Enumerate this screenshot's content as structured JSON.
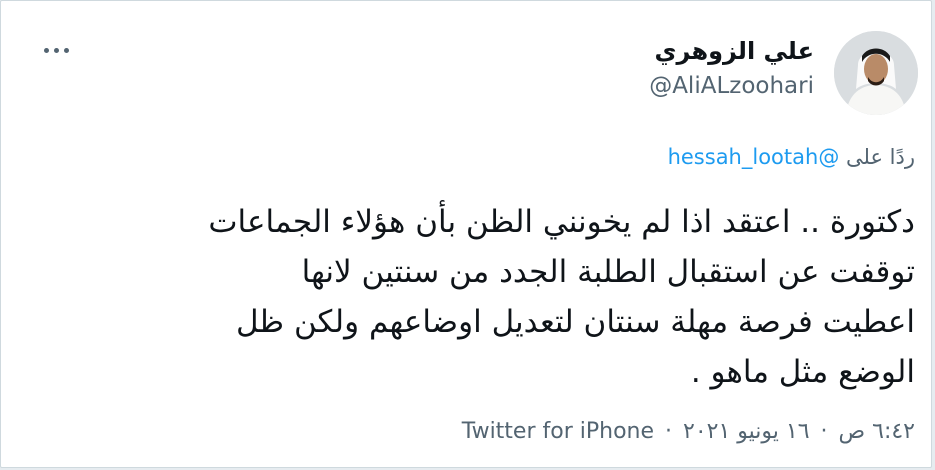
{
  "tweet": {
    "author": {
      "name": "علي الزوهري",
      "handle": "@AliALzoohari"
    },
    "reply": {
      "prefix": "ردًا على",
      "mention": "@hessah_lootah"
    },
    "text_lines": [
      "دكتورة .. اعتقد اذا لم يخونني الظن بأن هؤلاء الجماعات",
      "توقفت عن استقبال الطلبة الجدد من سنتين لانها",
      "اعطيت فرصة مهلة سنتان لتعديل اوضاعهم ولكن ظل",
      "الوضع مثل ماهو ."
    ],
    "meta": {
      "time": "٦:٤٢ ص",
      "separator": "·",
      "date": "١٦ يونيو ٢٠٢١",
      "source": "Twitter for iPhone"
    }
  },
  "icons": {
    "more": "more-horizontal-icon",
    "avatar": "profile-photo"
  },
  "colors": {
    "text": "#0f1419",
    "muted": "#536471",
    "link": "#1d9bf0",
    "border": "#cfd9de"
  }
}
